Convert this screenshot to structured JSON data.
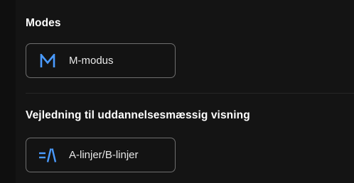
{
  "modes": {
    "title": "Modes",
    "button": {
      "label": "M-modus",
      "icon": "m-mode-icon"
    }
  },
  "guidance": {
    "title": "Vejledning til uddannelsesmæssig visning",
    "button": {
      "label": "A-linjer/B-linjer",
      "icon": "ab-lines-icon"
    }
  },
  "colors": {
    "background": "#141414",
    "accent": "#4a9bff",
    "button_border": "#6e6e6e",
    "text": "#ffffff"
  }
}
